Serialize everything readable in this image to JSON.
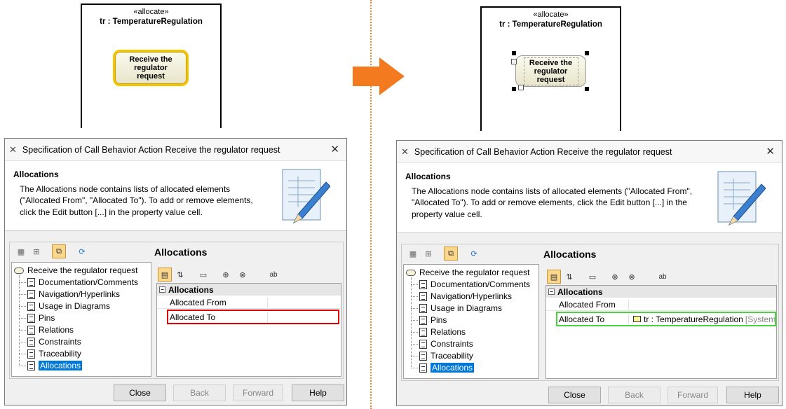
{
  "colors": {
    "arrow": "#f47a20",
    "selection": "#0078d7",
    "highlight_before": "#e00000",
    "highlight_after": "#4bd33b",
    "action_border_selected": "#f5c400"
  },
  "before": {
    "diagram": {
      "stereotype": "«allocate»",
      "lane_name": "tr : TemperatureRegulation",
      "action_label": "Receive the regulator request"
    },
    "dialog": {
      "title": "Specification of Call Behavior Action Receive the regulator request",
      "info_heading": "Allocations",
      "info_lines": [
        "The Allocations node contains lists of allocated elements",
        "(\"Allocated From\", \"Allocated To\"). To add or remove elements,",
        "click the Edit button [...] in the property value cell."
      ],
      "section_title": "Allocations",
      "tree_root": "Receive the regulator request",
      "tree_items": [
        "Documentation/Comments",
        "Navigation/Hyperlinks",
        "Usage in Diagrams",
        "Pins",
        "Relations",
        "Constraints",
        "Traceability",
        "Allocations"
      ],
      "group_label": "Allocations",
      "props": [
        {
          "name": "Allocated From",
          "value": ""
        },
        {
          "name": "Allocated To",
          "value": ""
        }
      ],
      "buttons": {
        "close": "Close",
        "back": "Back",
        "forward": "Forward",
        "help": "Help"
      }
    }
  },
  "after": {
    "diagram": {
      "stereotype": "«allocate»",
      "lane_name": "tr : TemperatureRegulation",
      "action_label": "Receive the regulator request"
    },
    "dialog": {
      "title": "Specification of Call Behavior Action Receive the regulator request",
      "info_heading": "Allocations",
      "info_lines": [
        "The Allocations node contains lists of allocated elements (\"Allocated From\",",
        "\"Allocated To\"). To add or remove elements, click the Edit button [...] in the",
        "property value cell."
      ],
      "section_title": "Allocations",
      "tree_root": "Receive the regulator request",
      "tree_items": [
        "Documentation/Comments",
        "Navigation/Hyperlinks",
        "Usage in Diagrams",
        "Pins",
        "Relations",
        "Constraints",
        "Traceability",
        "Allocations"
      ],
      "group_label": "Allocations",
      "props": [
        {
          "name": "Allocated From",
          "value": ""
        },
        {
          "name": "Allocated To",
          "value": "tr : TemperatureRegulation",
          "value_suffix": "[System"
        }
      ],
      "buttons": {
        "close": "Close",
        "back": "Back",
        "forward": "Forward",
        "help": "Help"
      }
    }
  }
}
